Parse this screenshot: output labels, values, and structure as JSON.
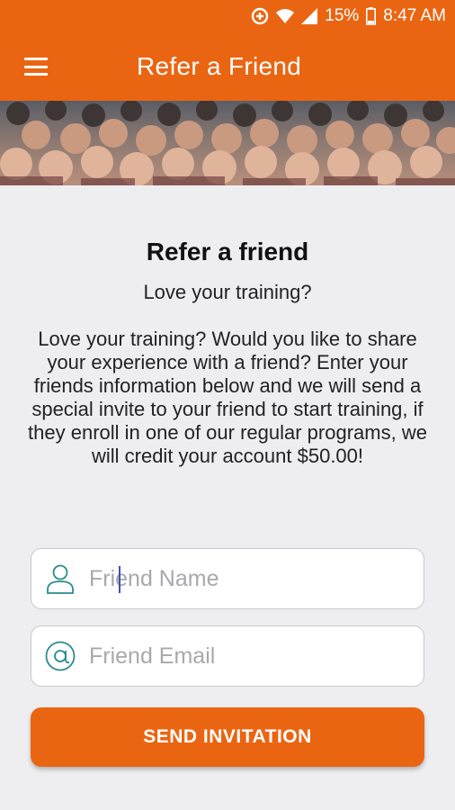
{
  "status_bar": {
    "battery": "15%",
    "time": "8:47 AM"
  },
  "app_bar": {
    "title": "Refer a Friend"
  },
  "content": {
    "heading": "Refer a friend",
    "subheading": "Love your training?",
    "description": "Love your training? Would you like to share your experience with a friend? Enter your friends information below and we will send a special invite to your friend to start training, if they enroll in one of our regular programs, we will credit your account $50.00!"
  },
  "form": {
    "name_placeholder": "Friend Name",
    "email_placeholder": "Friend Email",
    "send_label": "SEND INVITATION"
  },
  "colors": {
    "accent": "#ea6512",
    "icon_teal": "#2a8c8a"
  },
  "icons": {
    "name_field": "person-icon",
    "email_field": "at-sign-icon"
  }
}
